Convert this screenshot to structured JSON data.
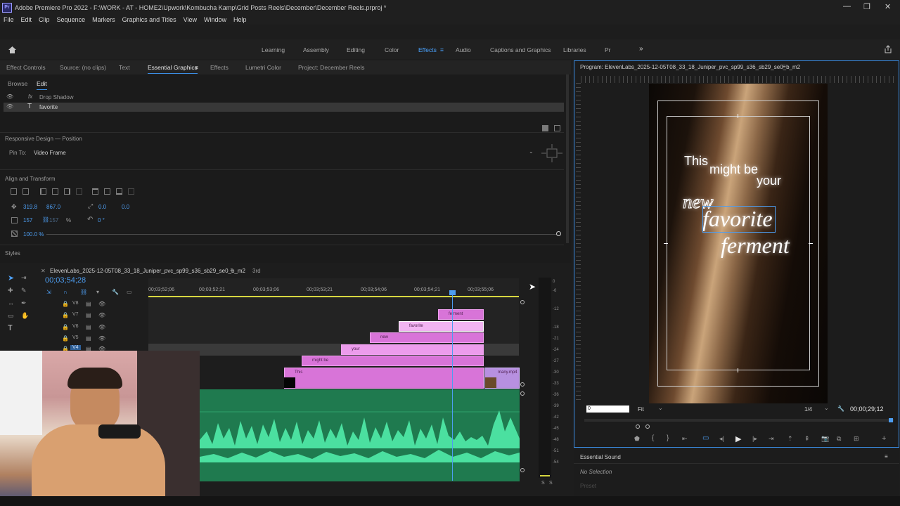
{
  "window": {
    "title": "Adobe Premiere Pro 2022 - F:\\WORK - AT - HOME2\\Upwork\\Kombucha Kamp\\Grid Posts Reels\\December\\December Reels.prproj *",
    "app_logo": "Pr"
  },
  "menu": [
    "File",
    "Edit",
    "Clip",
    "Sequence",
    "Markers",
    "Graphics and Titles",
    "View",
    "Window",
    "Help"
  ],
  "workspaces": [
    "Learning",
    "Assembly",
    "Editing",
    "Color",
    "Effects",
    "Audio",
    "Captions and Graphics",
    "Libraries",
    "Pr"
  ],
  "workspaces_more": "»",
  "workspaces_active": "Effects",
  "left_panel": {
    "tabs": [
      "Effect Controls",
      "Source: (no clips)",
      "Text",
      "Essential Graphics",
      "Effects",
      "Lumetri Color",
      "Project: December Reels"
    ],
    "active_tab": "Essential Graphics",
    "subtabs": [
      "Browse",
      "Edit"
    ],
    "active_subtab": "Edit",
    "layers": [
      {
        "type": "fx",
        "name": "Drop Shadow"
      },
      {
        "type": "T",
        "name": "favorite"
      }
    ],
    "responsive_design_title": "Responsive Design — Position",
    "pin_to_label": "Pin To:",
    "pin_to_value": "Video Frame",
    "align_title": "Align and Transform",
    "position_x": "319.8",
    "position_y": "867.0",
    "anchor_x": "0.0",
    "anchor_y": "0.0",
    "scale_w": "157",
    "scale_h": "157",
    "scale_unit": "%",
    "rotation": "0 °",
    "opacity": "100.0 %",
    "styles_title": "Styles"
  },
  "timeline": {
    "sequence_name": "ElevenLabs_2025-12-05T08_33_18_Juniper_pvc_sp99_s36_sb29_se0_b_m2",
    "other_tab": "3rd",
    "timecode": "00;03;54;28",
    "ruler_ticks": [
      "00;03;52;06",
      "00;03;52;21",
      "00;03;53;06",
      "00;03;53;21",
      "00;03;54;06",
      "00;03;54;21",
      "00;03;55;06"
    ],
    "tracks": [
      "V8",
      "V7",
      "V6",
      "V5",
      "V4"
    ],
    "clips": [
      "ferment",
      "favorite",
      "new",
      "your",
      "might be",
      "This",
      "many.mp4"
    ],
    "meter_scale": [
      "0",
      "-6",
      "-12",
      "-18",
      "-21",
      "-24",
      "-27",
      "-30",
      "-33",
      "-36",
      "-39",
      "-42",
      "-45",
      "-48",
      "-51",
      "-54"
    ],
    "meter_solo": [
      "S",
      "S"
    ]
  },
  "program": {
    "title": "Program: ElevenLabs_2025-12-05T08_33_18_Juniper_pvc_sp99_s36_sb29_se0_b_m2",
    "overlay_lines": [
      "This",
      "might be",
      "your",
      "new",
      "favorite",
      "ferment"
    ],
    "timecode_in": "0",
    "fit": "Fit",
    "resolution": "1/4",
    "duration": "00;00;29;12"
  },
  "essential_sound": {
    "title": "Essential Sound",
    "no_selection": "No Selection",
    "preset_label": "Preset"
  }
}
